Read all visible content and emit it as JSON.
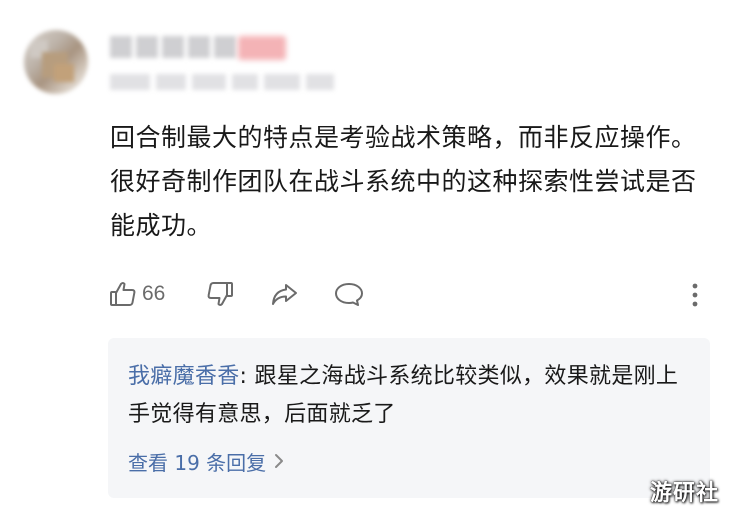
{
  "comment": {
    "text": "回合制最大的特点是考验战术策略，而非反应操作。很好奇制作团队在战斗系统中的这种探索性尝试是否能成功。",
    "like_count": "66"
  },
  "actions": {
    "like_icon": "thumbs-up-icon",
    "dislike_icon": "thumbs-down-icon",
    "share_icon": "share-icon",
    "reply_icon": "comment-bubble-icon",
    "more_icon": "more-vertical-icon"
  },
  "reply": {
    "author": "我癖魔香香",
    "separator": ": ",
    "text": "跟星之海战斗系统比较类似，效果就是刚上手觉得有意思，后面就乏了",
    "view_more": "查看 19 条回复"
  },
  "watermark": "游研社",
  "colors": {
    "link": "#4a6ea8",
    "text": "#191919",
    "icon": "#6b6b6b",
    "reply_bg": "#f5f6f8"
  }
}
